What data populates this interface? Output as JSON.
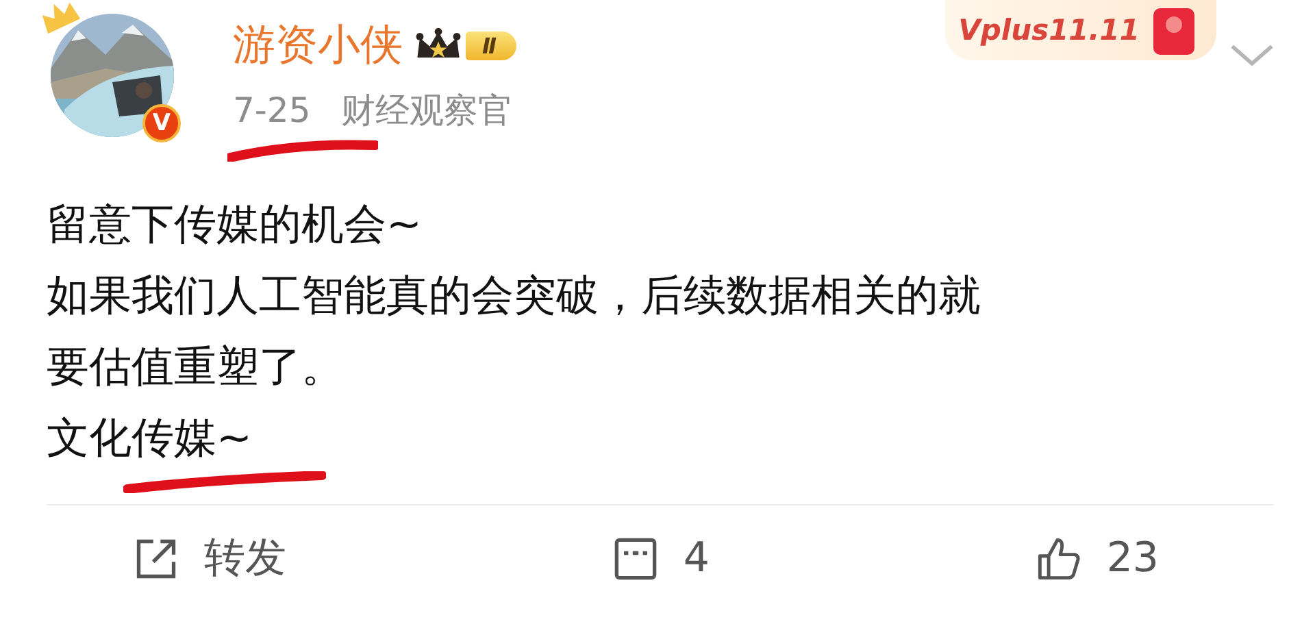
{
  "author": {
    "name": "游资小侠",
    "verified_mark": "V",
    "member_level": "Ⅱ"
  },
  "meta": {
    "date": "7-25",
    "date_marked": true,
    "title": "财经观察官"
  },
  "promo": {
    "text": "Vplus11.11"
  },
  "post": {
    "lines": [
      [
        {
          "text": "留意下传媒的机会~",
          "marked": false
        }
      ],
      [
        {
          "text": "如果我们人工智能真的会突破，后续数据相关的就",
          "marked": false
        }
      ],
      [
        {
          "text": "要估值重塑了。",
          "marked": false
        }
      ],
      [
        {
          "text": "文化",
          "marked": false
        },
        {
          "text": "传媒~",
          "marked": true
        }
      ]
    ]
  },
  "actions": [
    {
      "kind": "repost",
      "label": "转发"
    },
    {
      "kind": "comment",
      "label": "4"
    },
    {
      "kind": "like",
      "label": "23"
    }
  ]
}
